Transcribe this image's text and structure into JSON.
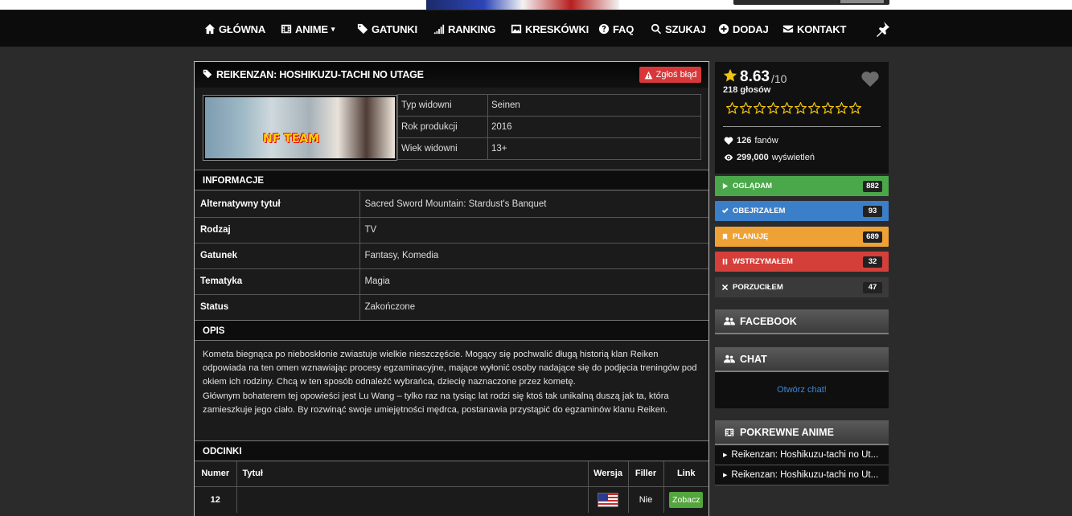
{
  "nav": {
    "items": [
      {
        "label": "GŁÓWNA",
        "icon": "home-icon"
      },
      {
        "label": "ANIME",
        "icon": "film-icon"
      },
      {
        "label": "GATUNKI",
        "icon": "tags-icon"
      },
      {
        "label": "RANKING",
        "icon": "signal-icon"
      },
      {
        "label": "KRESKÓWKI",
        "icon": "picture-icon"
      },
      {
        "label": "FAQ",
        "icon": "question-icon"
      },
      {
        "label": "SZUKAJ",
        "icon": "search-icon"
      },
      {
        "label": "DODAJ",
        "icon": "plus-icon"
      },
      {
        "label": "KONTAKT",
        "icon": "envelope-icon"
      }
    ],
    "anime_caret": "▾"
  },
  "anime": {
    "title": "REIKENZAN: HOSHIKUZU-TACHI NO UTAGE",
    "report_label": "Zgłoś błąd",
    "cover_logo": "NF TEAM",
    "meta": [
      {
        "key": "Typ widowni",
        "value": "Seinen"
      },
      {
        "key": "Rok produkcji",
        "value": "2016"
      },
      {
        "key": "Wiek widowni",
        "value": "13+"
      }
    ],
    "info_header": "INFORMACJE",
    "details": [
      {
        "key": "Alternatywny tytuł",
        "value": "Sacred Sword Mountain: Stardust's Banquet"
      },
      {
        "key": "Rodzaj",
        "value": "TV"
      },
      {
        "key": "Gatunek",
        "value": "Fantasy, Komedia"
      },
      {
        "key": "Tematyka",
        "value": "Magia"
      },
      {
        "key": "Status",
        "value": "Zakończone"
      }
    ],
    "desc_header": "OPIS",
    "description_1": "Kometa biegnąca po nieboskłonie zwiastuje wielkie nieszczęście. Mogący się pochwalić długą historią klan Reiken odpowiada na ten omen wznawiając procesy egzaminacyjne, mające wyłonić osoby nadające się do podjęcia treningów pod okiem ich rodziny. Chcą w ten sposób odnaleźć wybrańca, dziecię naznaczone przez kometę.",
    "description_2": "Głównym bohaterem tej opowieści jest Lu Wang – tylko raz na tysiąc lat rodzi się ktoś tak unikalną duszą jak ta, która zamieszkuje jego ciało. By rozwinąć swoje umiejętności mędrca, postanawia przystąpić do egzaminów klanu Reiken.",
    "episodes_header": "ODCINKI",
    "episode_columns": {
      "number": "Numer",
      "title": "Tytuł",
      "version": "Wersja",
      "filler": "Filler",
      "link": "Link"
    },
    "episodes": [
      {
        "number": "12",
        "title": "",
        "filler": "Nie",
        "link_label": "Zobacz"
      }
    ]
  },
  "sidebar": {
    "score": "8.63",
    "score_max": "/10",
    "votes": "218 głosów",
    "fans_count": "126",
    "fans_label": "fanów",
    "views_count": "299,000",
    "views_label": "wyświetleń",
    "statuses": [
      {
        "label": "Oglądam",
        "count": "882",
        "color": "#4aa84a",
        "icon": "play-icon"
      },
      {
        "label": "Obejrzałem",
        "count": "93",
        "color": "#3c7fc9",
        "icon": "check-icon"
      },
      {
        "label": "Planuję",
        "count": "689",
        "color": "#eea236",
        "icon": "bookmark-icon"
      },
      {
        "label": "Wstrzymałem",
        "count": "32",
        "color": "#d43f3a",
        "icon": "pause-icon"
      },
      {
        "label": "Porzuciłem",
        "count": "47",
        "color": "#3a3a3a",
        "icon": "close-icon"
      }
    ],
    "facebook": "FACEBOOK",
    "chat": "CHAT",
    "chat_link": "Otwórz chat!",
    "related_header": "POKREWNE ANIME",
    "related": [
      "Reikenzan: Hoshikuzu-tachi no Ut...",
      "Reikenzan: Hoshikuzu-tachi no Ut..."
    ]
  }
}
